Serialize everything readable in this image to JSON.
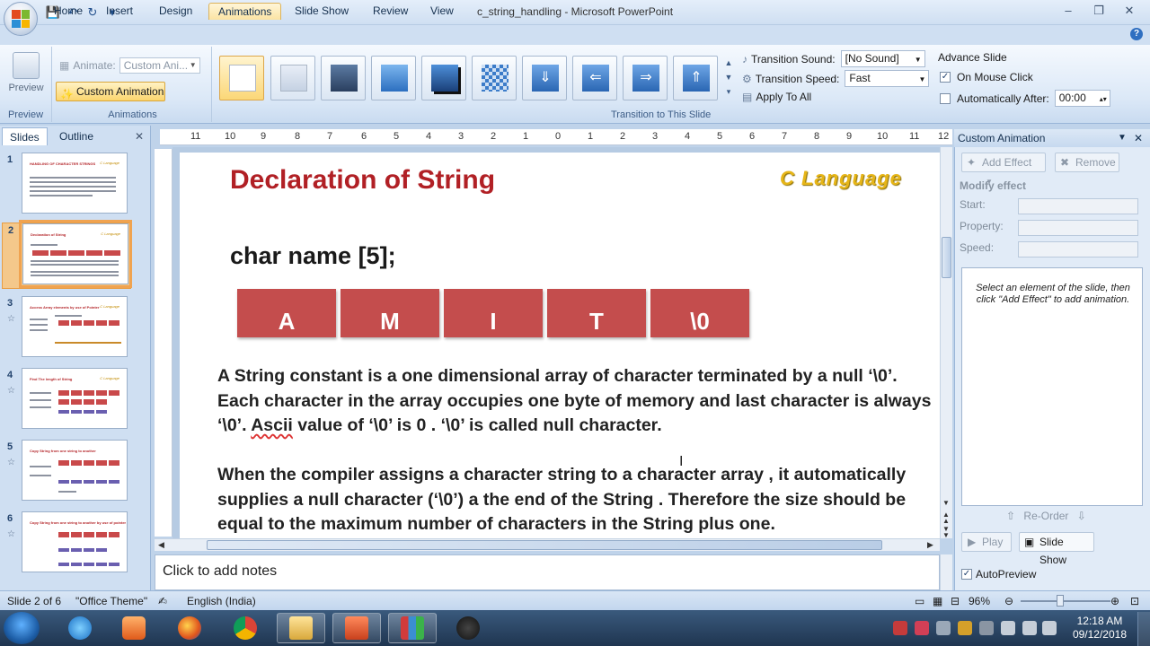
{
  "window": {
    "title": "c_string_handling - Microsoft PowerPoint",
    "qat_icons": [
      "save-icon",
      "undo-icon",
      "redo-icon",
      "customize-icon"
    ],
    "controls": {
      "minimize": "–",
      "restore": "❐",
      "close": "✕"
    }
  },
  "tabs": [
    "Home",
    "Insert",
    "Design",
    "Animations",
    "Slide Show",
    "Review",
    "View"
  ],
  "active_tab": "Animations",
  "ribbon": {
    "preview_label": "Preview",
    "preview_group": "Preview",
    "animate_label": "Animate:",
    "animate_value": "Custom Ani...",
    "custom_animation_label": "Custom Animation",
    "animations_group": "Animations",
    "transition_group": "Transition to This Slide",
    "transition_sound_label": "Transition Sound:",
    "transition_sound_value": "[No Sound]",
    "transition_speed_label": "Transition Speed:",
    "transition_speed_value": "Fast",
    "apply_to_all_label": "Apply To All",
    "advance_slide_label": "Advance Slide",
    "on_mouse_click_label": "On Mouse Click",
    "on_mouse_click_checked": true,
    "auto_after_label": "Automatically After:",
    "auto_after_checked": false,
    "auto_after_value": "00:00"
  },
  "left_pane": {
    "tabs": [
      "Slides",
      "Outline"
    ],
    "active": "Slides",
    "close": "✕",
    "slides": [
      {
        "num": "1",
        "title": "HANDLING OF CHARACTER  STRINGS"
      },
      {
        "num": "2",
        "title": "Declaration of String"
      },
      {
        "num": "3",
        "title": "Access Array elements  by use of Pointer"
      },
      {
        "num": "4",
        "title": "Find The length of String"
      },
      {
        "num": "5",
        "title": "Copy String from one string to another"
      },
      {
        "num": "6",
        "title": "Copy String from one string to another by use of pointer"
      }
    ],
    "thumb_logo": "C Language",
    "selected": 1
  },
  "ruler_ticks": [
    "11",
    "10",
    "9",
    "8",
    "7",
    "6",
    "5",
    "4",
    "3",
    "2",
    "1",
    "0",
    "1",
    "2",
    "3",
    "4",
    "5",
    "6",
    "7",
    "8",
    "9",
    "10",
    "11",
    "12"
  ],
  "slide": {
    "title": "Declaration of String",
    "logo": "C Language",
    "declaration": "char name [5];",
    "cells": [
      "A",
      "M",
      "I",
      "T",
      "\\0"
    ],
    "para1_a": "A String constant is a one dimensional array of character terminated by a null ‘\\0’. Each character in the array occupies one byte of memory and last character is always ‘\\0’.  ",
    "para1_ascii": "Ascii",
    "para1_b": " value of ‘\\0’ is 0 . ‘\\0’ is called null character.",
    "para2": "When the compiler assigns a character string to a character array , it automatically supplies a null character (‘\\0’) a the end of the String . Therefore the size should be equal to the maximum number of characters in the String plus one."
  },
  "notes_placeholder": "Click to add notes",
  "custom_animation_pane": {
    "title": "Custom Animation",
    "add_effect": "Add Effect",
    "remove": "Remove",
    "modify_effect": "Modify effect",
    "start_label": "Start:",
    "property_label": "Property:",
    "speed_label": "Speed:",
    "hint": "Select an element of the slide, then click \"Add Effect\" to add animation.",
    "reorder": "Re-Order",
    "play": "Play",
    "slide_show": "Slide Show",
    "autopreview_label": "AutoPreview",
    "autopreview_checked": true
  },
  "status": {
    "slide_info": "Slide 2 of 6",
    "theme": "\"Office Theme\"",
    "language": "English (India)",
    "zoom": "96%"
  },
  "taskbar": {
    "apps": [
      "internet-explorer",
      "media-player",
      "firefox",
      "chrome",
      "file-explorer",
      "powerpoint",
      "winrar",
      "obs"
    ],
    "clock_time": "12:18 AM",
    "clock_date": "09/12/2018"
  },
  "colors": {
    "slide_title": "#b12025",
    "cell_fill": "#c44d4d",
    "logo": "#e6b517",
    "ribbon_active": "#fbd56e"
  }
}
